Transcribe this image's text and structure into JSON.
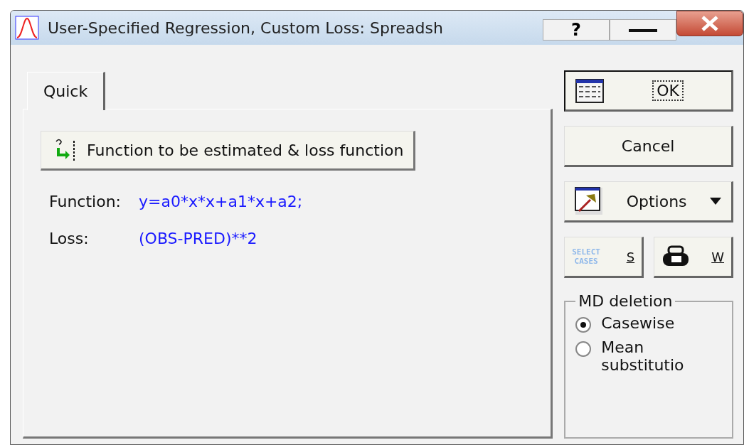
{
  "window": {
    "title": "User-Specified Regression, Custom Loss: Spreadsh",
    "help_button": "?"
  },
  "tabs": [
    {
      "label": "Quick",
      "selected": true
    }
  ],
  "function_button": {
    "label": "Function to be estimated & loss function"
  },
  "fields": [
    {
      "label": "Function:",
      "value": "y=a0*x*x+a1*x+a2;"
    },
    {
      "label": "Loss:",
      "value": "(OBS-PRED)**2"
    }
  ],
  "buttons": {
    "ok": "OK",
    "cancel": "Cancel",
    "options": "Options",
    "select_cases_icon": [
      "SELECT",
      "CASES"
    ],
    "select_cases": "S",
    "weights": "W"
  },
  "md_deletion": {
    "title": "MD deletion",
    "options": [
      {
        "label": "Casewise",
        "selected": true
      },
      {
        "label": "Mean substitutio",
        "selected": false
      }
    ]
  }
}
